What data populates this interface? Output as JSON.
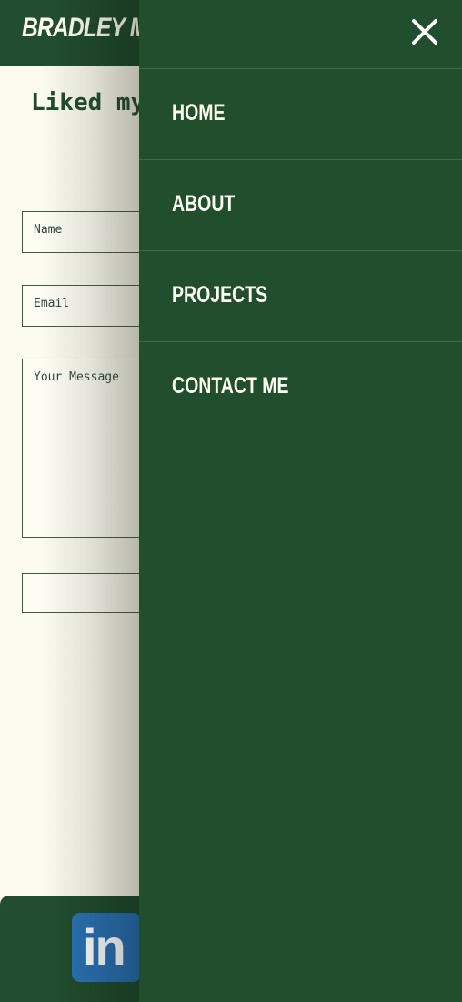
{
  "header": {
    "brand": "BRADLEY MILLER"
  },
  "contact": {
    "heading": "Liked my work?",
    "name_placeholder": "Name",
    "email_placeholder": "Email",
    "message_placeholder": "Your Message",
    "submit_label": ""
  },
  "footer": {
    "linkedin_label": "in"
  },
  "nav": {
    "items": [
      {
        "label": "HOME"
      },
      {
        "label": "ABOUT"
      },
      {
        "label": "PROJECTS"
      },
      {
        "label": "CONTACT ME"
      }
    ]
  },
  "colors": {
    "primary_green": "#214e2d",
    "background": "#fbfbf0",
    "linkedin_blue": "#2b72b3"
  },
  "icons": {
    "close": "close-icon",
    "linkedin": "linkedin-icon"
  }
}
